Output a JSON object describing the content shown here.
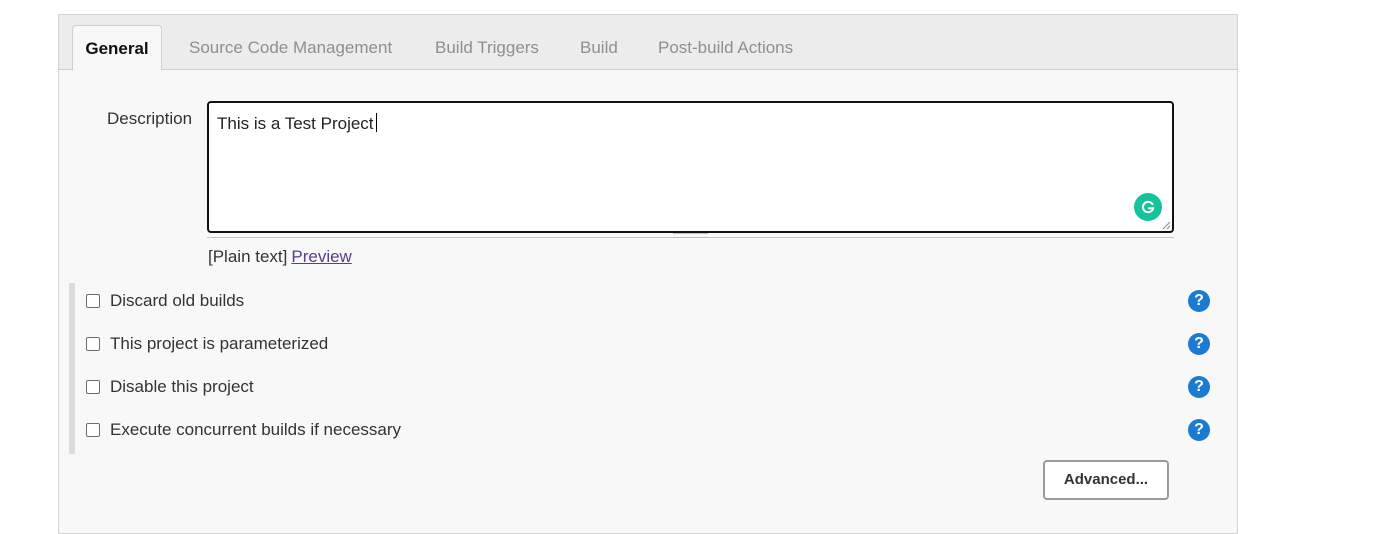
{
  "tabs": [
    {
      "label": "General",
      "active": true
    },
    {
      "label": "Source Code Management",
      "active": false
    },
    {
      "label": "Build Triggers",
      "active": false
    },
    {
      "label": "Build",
      "active": false
    },
    {
      "label": "Post-build Actions",
      "active": false
    }
  ],
  "description": {
    "label": "Description",
    "value": "This is a Test Project",
    "format_text": "[Plain text]",
    "preview_link": "Preview"
  },
  "options": [
    {
      "label": "Discard old builds",
      "checked": false,
      "help": "?"
    },
    {
      "label": "This project is parameterized",
      "checked": false,
      "help": "?"
    },
    {
      "label": "Disable this project",
      "checked": false,
      "help": "?"
    },
    {
      "label": "Execute concurrent builds if necessary",
      "checked": false,
      "help": "?"
    }
  ],
  "advanced_button": "Advanced...",
  "colors": {
    "panel_bg": "#f8f8f8",
    "help_icon": "#1b7bd1",
    "grammarly": "#15c39a",
    "link": "#5b3c88"
  },
  "icons": {
    "grammarly": "grammarly-icon",
    "help": "help-icon"
  }
}
